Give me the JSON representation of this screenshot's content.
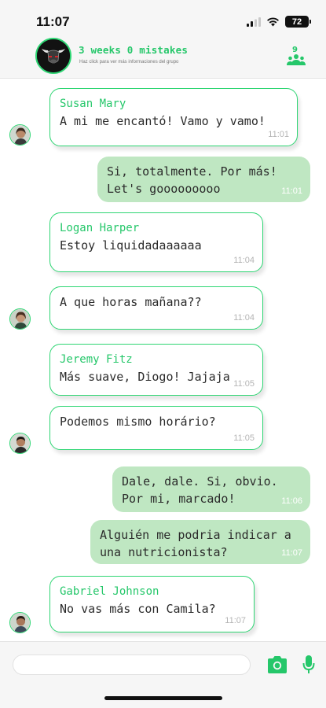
{
  "status": {
    "time": "11:07",
    "battery": "72"
  },
  "header": {
    "title": "3 weeks 0 mistakes",
    "subtitle": "Haz click para ver más informaciones del grupo",
    "member_count": "9"
  },
  "messages": [
    {
      "sender": "Susan Mary",
      "text": "A mi me encantó! Vamo y vamo!",
      "time": "11:01"
    },
    {
      "sender": "",
      "text": "Si, totalmente. Por más! Let's gooooooooo",
      "time": "11:01"
    },
    {
      "sender": "Logan Harper",
      "text": "Estoy liquidadaaaaaa",
      "time": "11:04"
    },
    {
      "sender": "",
      "text": "A que horas mañana??",
      "time": "11:04"
    },
    {
      "sender": "Jeremy Fitz",
      "text": "Más suave, Diogo! Jajaja",
      "time": "11:05"
    },
    {
      "sender": "",
      "text": "Podemos mismo horário?",
      "time": "11:05"
    },
    {
      "sender": "",
      "text": "Dale, dale. Si, obvio. Por mi, marcado!",
      "time": "11:06"
    },
    {
      "sender": "",
      "text": "Alguién me podria indicar a una nutricionista?",
      "time": "11:07"
    },
    {
      "sender": "Gabriel Johnson",
      "text": "No vas más con Camila?",
      "time": "11:07"
    }
  ],
  "composer": {
    "value": "",
    "placeholder": ""
  },
  "icons": {
    "signal": "cellular-signal-icon",
    "wifi": "wifi-icon",
    "battery": "battery-icon",
    "group": "group-members-icon",
    "camera": "camera-icon",
    "mic": "microphone-icon"
  },
  "colors": {
    "accent": "#25c76a",
    "outgoing_bubble": "#bfe7c2",
    "incoming_border": "#2ed673"
  }
}
